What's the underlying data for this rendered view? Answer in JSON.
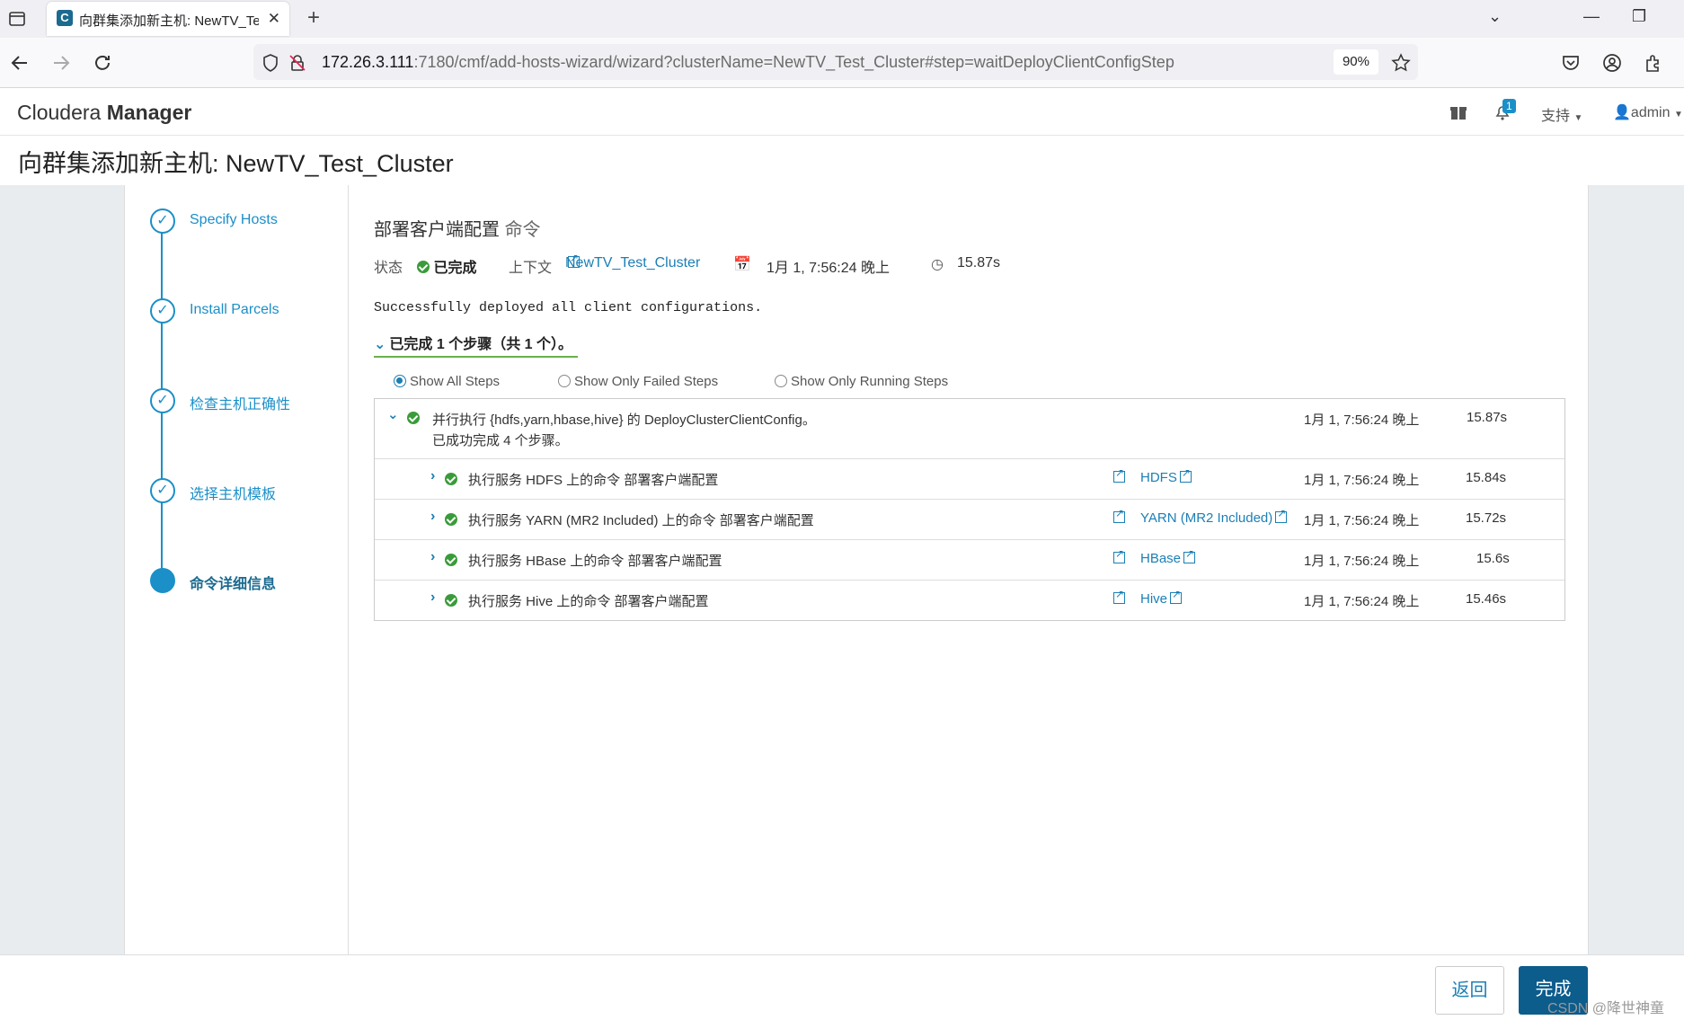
{
  "browser": {
    "tab_title": "向群集添加新主机: NewTV_Test_Cluster",
    "favicon_letter": "C",
    "url_host": "172.26.3.111",
    "url_path": ":7180/cmf/add-hosts-wizard/wizard?clusterName=NewTV_Test_Cluster#step=waitDeployClientConfigStep",
    "zoom": "90%"
  },
  "header": {
    "brand_light": "Cloudera",
    "brand_bold": "Manager",
    "notification_count": "1",
    "support_label": "支持",
    "user_label": "admin"
  },
  "page": {
    "title": "向群集添加新主机: NewTV_Test_Cluster"
  },
  "wizard_steps": [
    {
      "label": "Specify Hosts",
      "state": "done"
    },
    {
      "label": "Install Parcels",
      "state": "done"
    },
    {
      "label": "检查主机正确性",
      "state": "done"
    },
    {
      "label": "选择主机模板",
      "state": "done"
    },
    {
      "label": "命令详细信息",
      "state": "active"
    }
  ],
  "command": {
    "title": "部署客户端配置",
    "title_suffix": "命令",
    "status_label": "状态",
    "status_value": "已完成",
    "context_label": "上下文",
    "context_link": "NewTV_Test_Cluster",
    "timestamp": "1月 1, 7:56:24 晚上",
    "duration": "15.87s",
    "message": "Successfully deployed all client configurations.",
    "summary": "已完成 1 个步骤（共 1 个）。"
  },
  "filters": {
    "all": "Show All Steps",
    "failed": "Show Only Failed Steps",
    "running": "Show Only Running Steps",
    "selected": "all"
  },
  "parent_step": {
    "description": "并行执行 {hdfs,yarn,hbase,hive} 的 DeployClusterClientConfig。",
    "sub_description": "已成功完成 4 个步骤。",
    "time": "1月 1, 7:56:24 晚上",
    "duration": "15.87s"
  },
  "child_steps": [
    {
      "description": "执行服务 HDFS 上的命令 部署客户端配置",
      "service": "HDFS",
      "time": "1月 1, 7:56:24 晚上",
      "duration": "15.84s"
    },
    {
      "description": "执行服务 YARN (MR2 Included) 上的命令 部署客户端配置",
      "service": "YARN (MR2 Included)",
      "time": "1月 1, 7:56:24 晚上",
      "duration": "15.72s"
    },
    {
      "description": "执行服务 HBase 上的命令 部署客户端配置",
      "service": "HBase",
      "time": "1月 1, 7:56:24 晚上",
      "duration": "15.6s"
    },
    {
      "description": "执行服务 Hive 上的命令 部署客户端配置",
      "service": "Hive",
      "time": "1月 1, 7:56:24 晚上",
      "duration": "15.46s"
    }
  ],
  "footer": {
    "back_label": "返回",
    "finish_label": "完成",
    "watermark": "CSDN @降世神童"
  },
  "colors": {
    "accent": "#1b8fc8",
    "link": "#1b7fb5",
    "success": "#3a9b3a",
    "primary_button": "#0c5c8c"
  }
}
